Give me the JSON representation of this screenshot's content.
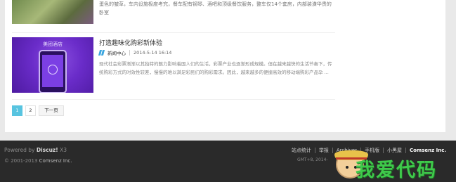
{
  "articles": [
    {
      "excerpt": "蛋色的皱草，车内设施极度考究，餐车配有钢琴、酒吧和顶级餐饮服务，整车仅14个套房，内部装潢华贵的卧室"
    },
    {
      "thumb_caption": "美团酒店",
      "title": "打造趣味化购彩新体验",
      "category": "新闻中心",
      "date": "2014-5-14 16:14",
      "excerpt": "现代社会彩票渐渐以其独特的魅力影响着国人们的生活，彩票产业也逐渐形成规模。但在越来越快的生活节奏下，传统购彩方式的时效性较差，慢慢的难以满足彩民们的购彩需求。因此，越来越多的便捷高效的移动端购彩产品孕 ..."
    }
  ],
  "pagination": {
    "current": "1",
    "page2": "2",
    "next": "下一页"
  },
  "footer": {
    "powered_prefix": "Powered by",
    "powered_brand": "Discuz!",
    "powered_version": "X3",
    "copyright_prefix": "© 2001-2013",
    "copyright_company": "Comsenz Inc.",
    "links": [
      "站点统计",
      "举报",
      "Archiver",
      "手机版",
      "小黑屋"
    ],
    "company": "Comsenz Inc.",
    "gmt": "GMT+8, 2014-"
  },
  "watermark": {
    "text": "我爱代码"
  },
  "colors": {
    "accent": "#58c4e0",
    "footer_bg": "#2a2a2a",
    "category_icon": "#3ba6df"
  }
}
